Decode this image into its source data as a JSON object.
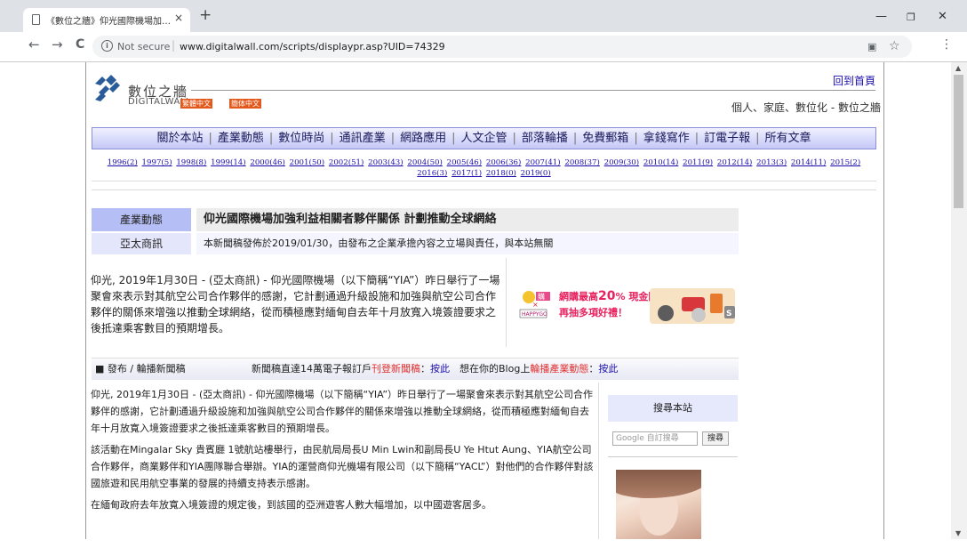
{
  "browser": {
    "tab_title": "《數位之牆》仰光國際機場加強利益",
    "tab_close": "×",
    "new_tab": "+",
    "not_secure": "Not secure",
    "url_separator": "|",
    "url": "www.digitalwall.com/scripts/displaypr.asp?UID=74329",
    "back_glyph": "←",
    "forward_glyph": "→",
    "reload_glyph": "C",
    "icons": [
      "page-icon",
      "back-icon",
      "forward-icon",
      "reload-icon",
      "info-icon",
      "translate-icon",
      "star-icon",
      "menu-icon",
      "minimize-icon",
      "maximize-icon",
      "close-icon"
    ]
  },
  "site": {
    "logo_cn": "數位之牆",
    "logo_en": "DIGITALWALL",
    "lang_trad": "繁體中文",
    "lang_simp": "簡体中文",
    "home_link": "回到首頁",
    "tagline": "個人、家庭、數位化 - 數位之牆",
    "accent_color": "#b5bef5",
    "brand_orange": "#e2591b"
  },
  "nav": [
    "關於本站",
    "產業動態",
    "數位時尚",
    "通訊產業",
    "網路應用",
    "人文企管",
    "部落輪播",
    "免費郵箱",
    "拿錢寫作",
    "訂電子報",
    "所有文章"
  ],
  "years": [
    "1996(2)",
    "1997(5)",
    "1998(8)",
    "1999(14)",
    "2000(46)",
    "2001(50)",
    "2002(51)",
    "2003(43)",
    "2004(50)",
    "2005(46)",
    "2006(36)",
    "2007(41)",
    "2008(37)",
    "2009(30)",
    "2010(14)",
    "2011(9)",
    "2012(14)",
    "2013(3)",
    "2014(11)",
    "2015(2)",
    "2016(3)",
    "2017(1)",
    "2018(0)",
    "2019(0)"
  ],
  "article": {
    "category": "產業動態",
    "title": "仰光國際機場加強利益相關者夥伴關係 計劃推動全球網絡",
    "source": "亞太商訊",
    "disclaimer": "本新聞稿發佈於2019/01/30，由發布之企業承擔內容之立場與責任，與本站無關",
    "summary": "仰光, 2019年1月30日 - (亞太商訊) - 仰光國際機場（以下簡稱“YIA”）昨日舉行了一場聚會來表示對其航空公司合作夥伴的感謝，它計劃通過升級設施和加強與航空公司合作夥伴的關係來增強以推動全球網絡，從而積極應對緬甸自去年十月放寬入境簽證要求之後抵達乘客數目的預期增長。",
    "paragraphs": [
      "仰光, 2019年1月30日 - (亞太商訊) - 仰光國際機場（以下簡稱“YIA”）昨日舉行了一場聚會來表示對其航空公司合作夥伴的感謝，它計劃通過升級設施和加強與航空公司合作夥伴的關係來增強以推動全球網絡，從而積極應對緬甸自去年十月放寬入境簽證要求之後抵達乘客數目的預期增長。",
      "該活動在Mingalar Sky 貴賓廳 1號航站樓舉行，由民航局局長U Min Lwin和副局長U Ye Htut Aung、YIA航空公司合作夥伴，商業夥伴和YIA團隊聯合舉辦。YIA的運營商仰光機場有限公司（以下簡稱“YACL”）對他們的合作夥伴對該國旅遊和民用航空事業的發展的持續支持表示感謝。",
      "在緬甸政府去年放寬入境簽證的規定後，到該國的亞洲遊客人數大幅增加，以中國遊客居多。"
    ]
  },
  "ad": {
    "brand_line1": "購",
    "brand_line2": "HAPPYGO",
    "headline1": "網購最高",
    "headline_num": "20",
    "headline2": "% 現金回饋",
    "subline": "再抽多項好禮！",
    "badge": "S"
  },
  "release_bar": {
    "label": "■ 發布 / 輪播新聞稿",
    "text_prefix": "新聞稿直達14萬電子報訂戶",
    "text_red1": "刊登新聞稿",
    "text_mid1": "：",
    "link1": "按此",
    "text_mid2": "　想在你的Blog上",
    "text_red2": "輪播產業動態",
    "text_mid3": "：",
    "link2": "按此"
  },
  "sidebar": {
    "search_title": "搜尋本站",
    "search_placeholder": "Google 自訂搜尋",
    "search_button": "搜尋"
  }
}
